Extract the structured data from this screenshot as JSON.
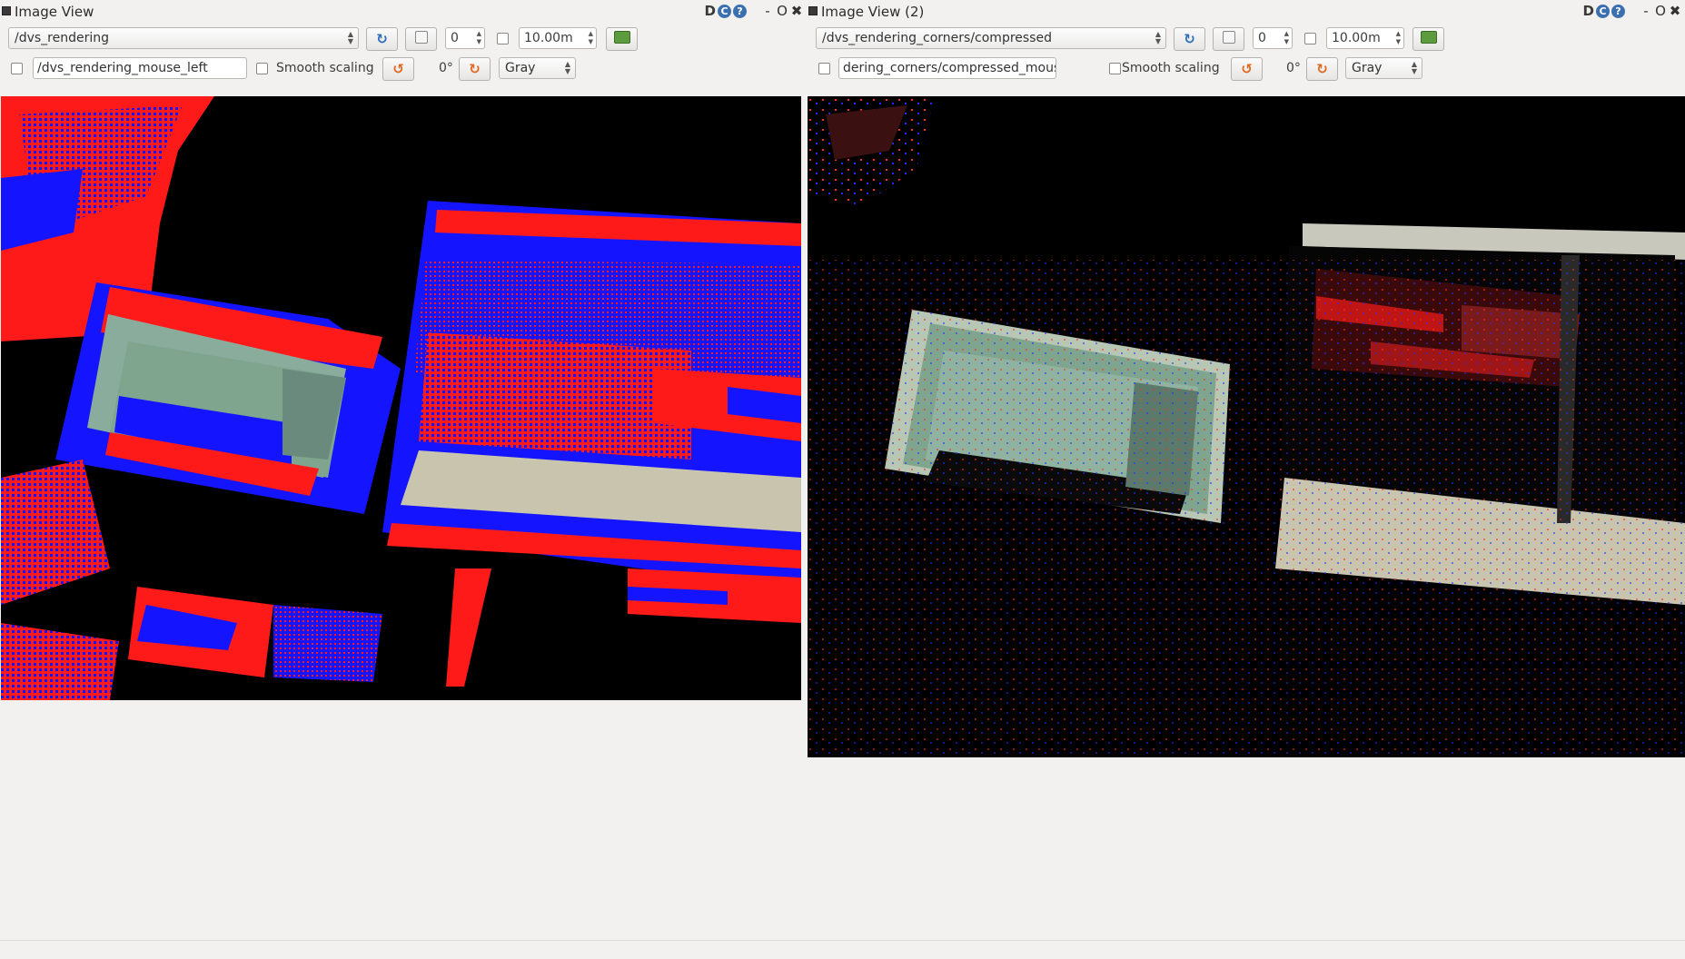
{
  "left_view": {
    "title": "Image View",
    "help_d": "D",
    "help_c": "C",
    "help_q": "?",
    "win_min": "-",
    "win_float": "O",
    "win_close": "✖",
    "topic": "/dvs_rendering",
    "refresh_icon": "refresh-icon",
    "pause_icon": "pause-icon",
    "spin_value": "0",
    "time_value": "10.00m",
    "save_icon": "save-icon",
    "mouse_topic": "/dvs_rendering_mouse_left",
    "smooth_label": "Smooth scaling",
    "rotate_ccw_icon": "rotate-ccw-icon",
    "rotation_label": "0°",
    "rotate_cw_icon": "rotate-cw-icon",
    "colormap": "Gray"
  },
  "right_view": {
    "title": "Image View (2)",
    "help_d": "D",
    "help_c": "C",
    "help_q": "?",
    "win_min": "-",
    "win_float": "O",
    "win_close": "✖",
    "topic": "/dvs_rendering_corners/compressed",
    "spin_value": "0",
    "time_value": "10.00m",
    "mouse_topic": "dering_corners/compressed_mouse_left",
    "smooth_label": "Smooth scaling",
    "rotation_label": "0°",
    "colormap": "Gray"
  },
  "colors": {
    "event_red": "#ff1a1a",
    "event_blue": "#1414ff",
    "frame_green": "#7fa58f",
    "frame_beige": "#c8c4ad",
    "background": "#f2f1f0"
  }
}
